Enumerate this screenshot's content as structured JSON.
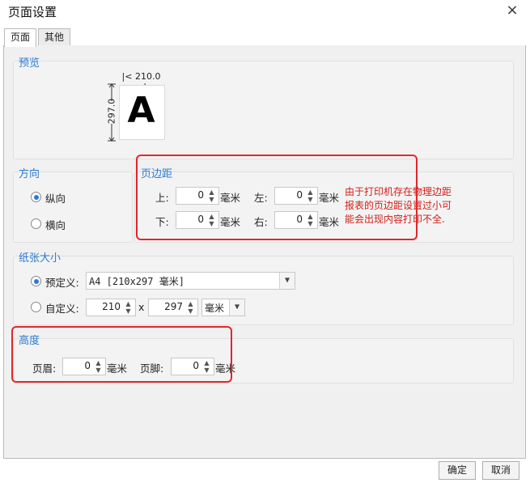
{
  "window": {
    "title": "页面设置",
    "close_icon": "×"
  },
  "tabs": [
    {
      "label": "页面"
    },
    {
      "label": "其他"
    }
  ],
  "preview": {
    "group_label": "预览",
    "width": "210.0",
    "height": "297.0",
    "letter": "A"
  },
  "orientation": {
    "group_label": "方向",
    "portrait": "纵向",
    "landscape": "横向",
    "selected": "portrait"
  },
  "margins": {
    "group_label": "页边距",
    "top_label": "上:",
    "top_value": "0",
    "top_unit": "毫米",
    "left_label": "左:",
    "left_value": "0",
    "left_unit": "毫米",
    "bottom_label": "下:",
    "bottom_value": "0",
    "bottom_unit": "毫米",
    "right_label": "右:",
    "right_value": "0",
    "right_unit": "毫米",
    "note_lines": [
      "由于打印机存在物理边距",
      "报表的页边距设置过小可",
      "能会出现内容打印不全."
    ]
  },
  "paper": {
    "group_label": "纸张大小",
    "predefined_label": "预定义:",
    "predefined_value": "A4 [210x297 毫米]",
    "custom_label": "自定义:",
    "custom_width": "210",
    "times": "x",
    "custom_height": "297",
    "unit": "毫米"
  },
  "height": {
    "group_label": "高度",
    "header_label": "页眉:",
    "header_value": "0",
    "header_unit": "毫米",
    "footer_label": "页脚:",
    "footer_value": "0",
    "footer_unit": "毫米"
  },
  "buttons": {
    "ok": "确定",
    "cancel": "取消"
  },
  "colors": {
    "accent": "#2b7bd0",
    "annotation": "#e2262b"
  }
}
